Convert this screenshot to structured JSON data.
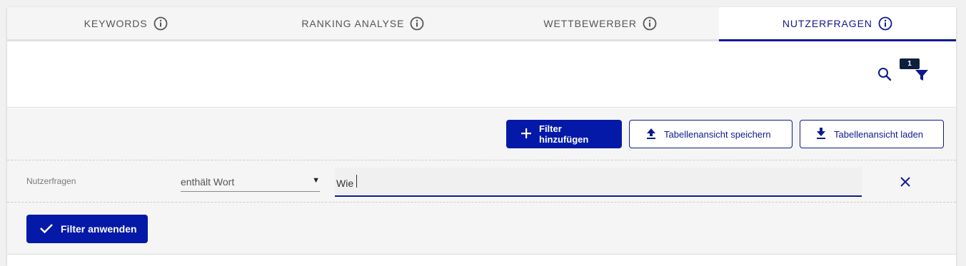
{
  "tabs": [
    {
      "label": "KEYWORDS",
      "active": false
    },
    {
      "label": "RANKING ANALYSE",
      "active": false
    },
    {
      "label": "WETTBEWERBER",
      "active": false
    },
    {
      "label": "NUTZERFRAGEN",
      "active": true
    }
  ],
  "toolbar": {
    "filter_badge_count": "1",
    "search_icon": "search-icon",
    "filter_icon": "funnel-icon"
  },
  "filter_panel": {
    "add_filter_label": "Filter hinzufügen",
    "save_view_label": "Tabellenansicht speichern",
    "load_view_label": "Tabellenansicht laden",
    "filter_row": {
      "field_label": "Nutzerfragen",
      "operator_value": "enthält Wort",
      "input_value": "Wie"
    },
    "apply_label": "Filter anwenden"
  },
  "colors": {
    "accent": "#0d1a8e",
    "primary_button": "#0519a8",
    "badge": "#0e1f3d",
    "panel_bg": "#f5f5f5"
  }
}
